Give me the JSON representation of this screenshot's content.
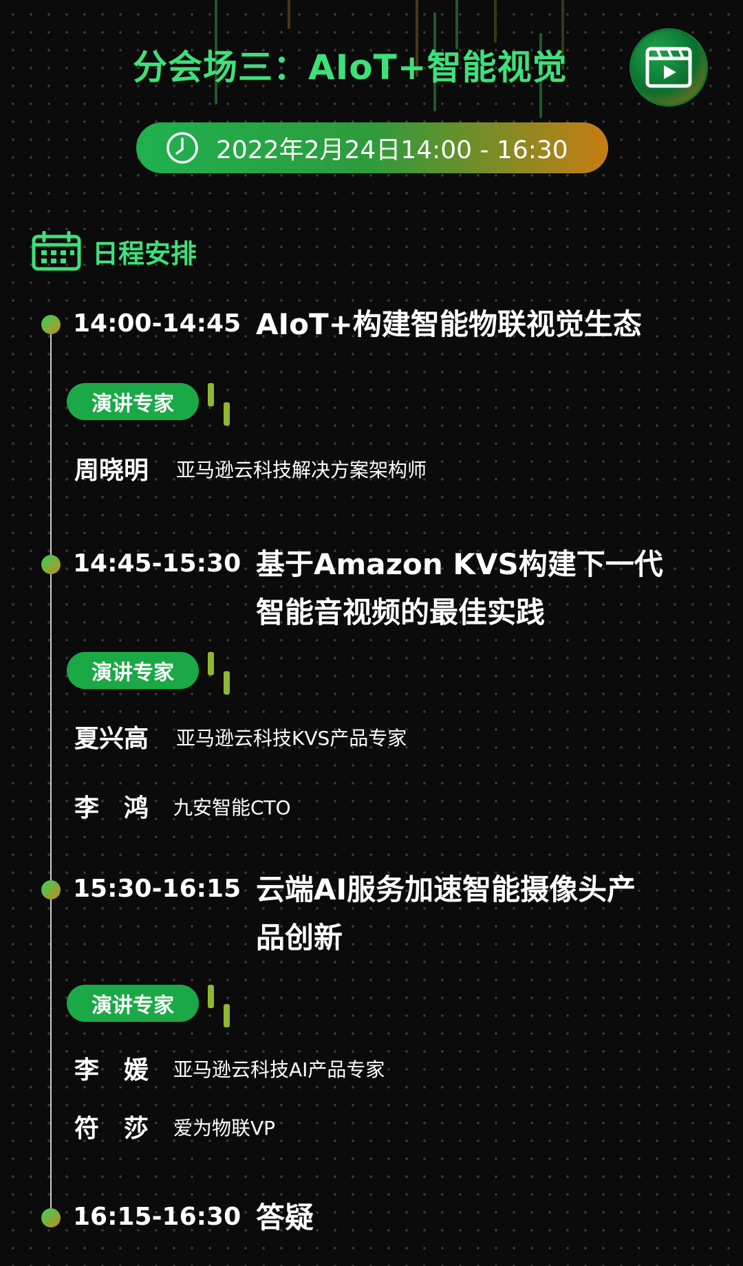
{
  "header": {
    "title": "分会场三：AIoT+智能视觉",
    "date": "2022年2月24日14:00 - 16:30"
  },
  "schedule": {
    "heading": "日程安排",
    "speaker_tag": "演讲专家",
    "sessions": [
      {
        "time": "14:00-14:45",
        "topic": "AIoT+构建智能物联视觉生态",
        "speakers": [
          {
            "name": "周晓明",
            "role": "亚马逊云科技解决方案架构师"
          }
        ]
      },
      {
        "time": "14:45-15:30",
        "topic": "基于Amazon KVS构建下一代智能音视频的最佳实践",
        "speakers": [
          {
            "name": "夏兴高",
            "role": "亚马逊云科技KVS产品专家"
          },
          {
            "name": "李　鸿",
            "role": "九安智能CTO"
          }
        ]
      },
      {
        "time": "15:30-16:15",
        "topic": "云端AI服务加速智能摄像头产品创新",
        "speakers": [
          {
            "name": "李　媛",
            "role": "亚马逊云科技AI产品专家"
          },
          {
            "name": "符　莎",
            "role": "爱为物联VP"
          }
        ]
      },
      {
        "time": "16:15-16:30",
        "topic": "答疑",
        "speakers": []
      }
    ]
  },
  "colors": {
    "accent_green": "#3ee07a",
    "tag_green": "#1ba847",
    "gradient_orange": "#c77d12",
    "background": "#0b0b0b"
  },
  "icons": [
    "video-icon",
    "clock-icon",
    "calendar-icon"
  ]
}
